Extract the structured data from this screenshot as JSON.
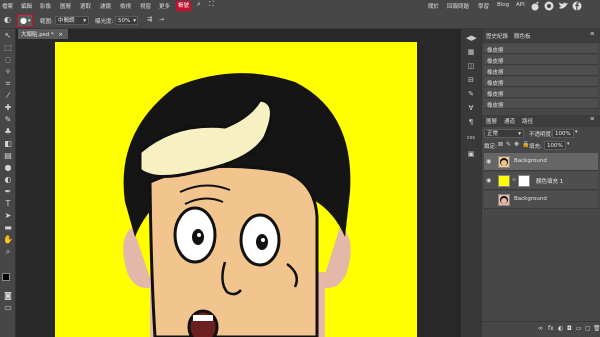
{
  "menubar": {
    "items": [
      "檔案",
      "編輯",
      "影像",
      "圖層",
      "選取",
      "濾鏡",
      "檢視",
      "視窗",
      "更多"
    ],
    "active_item": "帳號",
    "right_items": [
      "關於",
      "回報問題",
      "學習",
      "Blog",
      "API"
    ]
  },
  "options": {
    "range_label": "範圍:",
    "range_value": "中間調",
    "exposure_label": "曝光度:",
    "exposure_value": "50%"
  },
  "document": {
    "tab_label": "大頭貼.psd *",
    "background_color": "#ffff00"
  },
  "history": {
    "tabs": [
      "歷史紀錄",
      "顏色板"
    ],
    "rows": [
      "橡皮擦",
      "橡皮擦",
      "橡皮擦",
      "橡皮擦",
      "橡皮擦",
      "橡皮擦"
    ]
  },
  "layers": {
    "tabs": [
      "圖層",
      "通道",
      "路徑"
    ],
    "blend_mode": "正常",
    "opacity_label": "不透明度:",
    "opacity_value": "100%",
    "lock_label": "鎖定:",
    "fill_label": "填充:",
    "fill_value": "100%",
    "items": [
      {
        "name": "Background"
      },
      {
        "name": "顏色填充 1"
      },
      {
        "name": "Background"
      }
    ]
  },
  "colors": {
    "accent": "#c8102e",
    "panel_bg": "#474747",
    "canvas_bg": "#282828"
  }
}
